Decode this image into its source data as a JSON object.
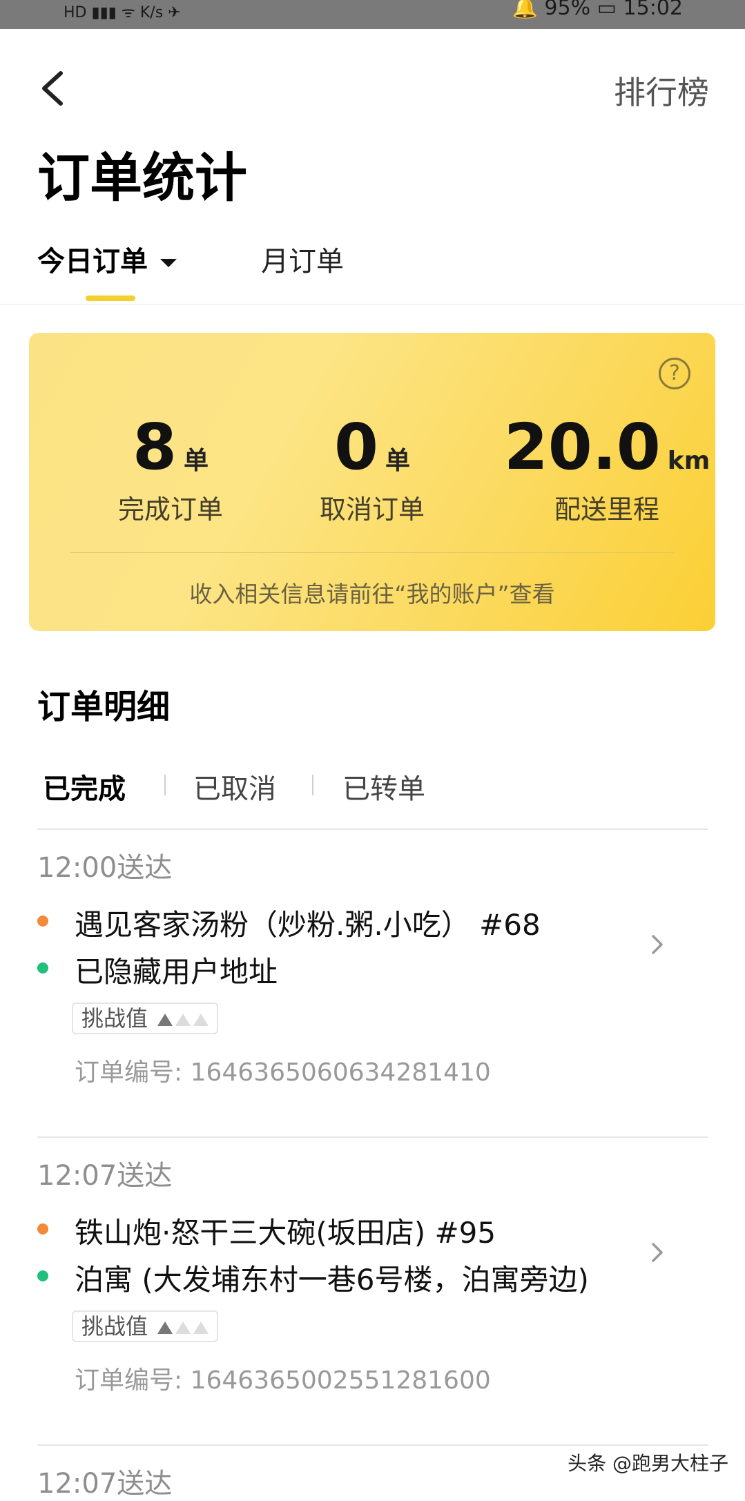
{
  "status_bar": {
    "left": "HD  ▮▮▮  ᯤ K/s  ✈",
    "right": "🔔 95%  ▭  15:02"
  },
  "header": {
    "ranking_label": "排行榜",
    "page_title": "订单统计"
  },
  "tabs": [
    {
      "label": "今日订单",
      "selected": true
    },
    {
      "label": "月订单",
      "selected": false
    }
  ],
  "summary": {
    "help_icon": "question-circle-icon",
    "completed": {
      "value": "8",
      "unit": "单",
      "label": "完成订单"
    },
    "cancelled": {
      "value": "0",
      "unit": "单",
      "label": "取消订单"
    },
    "distance": {
      "value": "20.0",
      "unit": "km",
      "label": "配送里程"
    },
    "note": "收入相关信息请前往“我的账户”查看",
    "colors": {
      "accent": "#f5cf2b",
      "card_start": "#fbe385",
      "card_end": "#fbcf34"
    }
  },
  "detail": {
    "title": "订单明细",
    "sub_tabs": [
      {
        "label": "已完成",
        "selected": true
      },
      {
        "label": "已取消",
        "selected": false
      },
      {
        "label": "已转单",
        "selected": false
      }
    ]
  },
  "orders": [
    {
      "time": "12:00送达",
      "shop": "遇见客家汤粉（炒粉.粥.小吃） #68",
      "user": "已隐藏用户地址",
      "challenge_label": "挑战值",
      "challenge_level": 1,
      "order_no": "订单编号: 1646365060634281410"
    },
    {
      "time": "12:07送达",
      "shop": "铁山炮·怒干三大碗(坂田店) #95",
      "user": "泊寓 (大发埔东村一巷6号楼，泊寓旁边)",
      "challenge_label": "挑战值",
      "challenge_level": 1,
      "order_no": "订单编号: 1646365002551281600"
    },
    {
      "time": "12:07送达"
    }
  ],
  "watermark": "头条 @跑男大柱子"
}
